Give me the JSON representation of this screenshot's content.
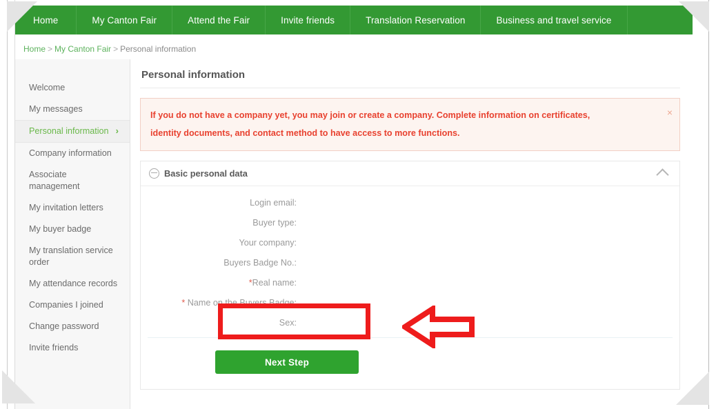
{
  "nav": {
    "items": [
      {
        "label": "Home"
      },
      {
        "label": "My Canton Fair"
      },
      {
        "label": "Attend the Fair"
      },
      {
        "label": "Invite friends"
      },
      {
        "label": "Translation Reservation"
      },
      {
        "label": "Business and travel service"
      }
    ]
  },
  "breadcrumb": {
    "home": "Home",
    "sep1": ">",
    "section": "My Canton Fair",
    "sep2": ">",
    "current": "Personal information"
  },
  "sidebar": {
    "items": [
      {
        "label": "Welcome",
        "active": false
      },
      {
        "label": "My messages",
        "active": false
      },
      {
        "label": "Personal information",
        "active": true,
        "chevron": "›"
      },
      {
        "label": "Company information",
        "active": false
      },
      {
        "label": "Associate management",
        "active": false
      },
      {
        "label": "My invitation letters",
        "active": false
      },
      {
        "label": "My buyer badge",
        "active": false
      },
      {
        "label": "My translation service order",
        "active": false
      },
      {
        "label": "My attendance records",
        "active": false
      },
      {
        "label": "Companies I joined",
        "active": false
      },
      {
        "label": "Change password",
        "active": false
      },
      {
        "label": "Invite friends",
        "active": false
      }
    ]
  },
  "main": {
    "page_title": "Personal information",
    "alert": {
      "line1": "If you do not have a company yet, you may join or create a company. Complete information on certificates,",
      "line2": "identity documents, and contact method to have access to more functions.",
      "close_icon": "×"
    },
    "card": {
      "title": "Basic personal data",
      "collapse_icon": "minus-circle-icon",
      "toggle_icon": "chevron-up-icon",
      "fields": [
        {
          "label": "Login email:",
          "required": false,
          "value": ""
        },
        {
          "label": "Buyer type:",
          "required": false,
          "value": ""
        },
        {
          "label": "Your company:",
          "required": false,
          "value": ""
        },
        {
          "label": "Buyers Badge No.:",
          "required": false,
          "value": ""
        },
        {
          "label": "Real name:",
          "required": true,
          "value": ""
        },
        {
          "label": "Name on the Buyers Badge:",
          "required": true,
          "value": ""
        },
        {
          "label": "Sex:",
          "required": false,
          "value": ""
        }
      ],
      "next_button": "Next Step"
    }
  },
  "annotations": {
    "highlight_box": "red-highlight-box",
    "pointer_arrow": "red-left-arrow",
    "color": "#ee1c1c"
  },
  "colors": {
    "nav_green": "#339933",
    "button_green": "#2fa32f",
    "accent_green": "#6ab84a",
    "alert_text": "#e8412f",
    "alert_bg": "#fdf4f0",
    "annotation_red": "#ee1c1c"
  }
}
